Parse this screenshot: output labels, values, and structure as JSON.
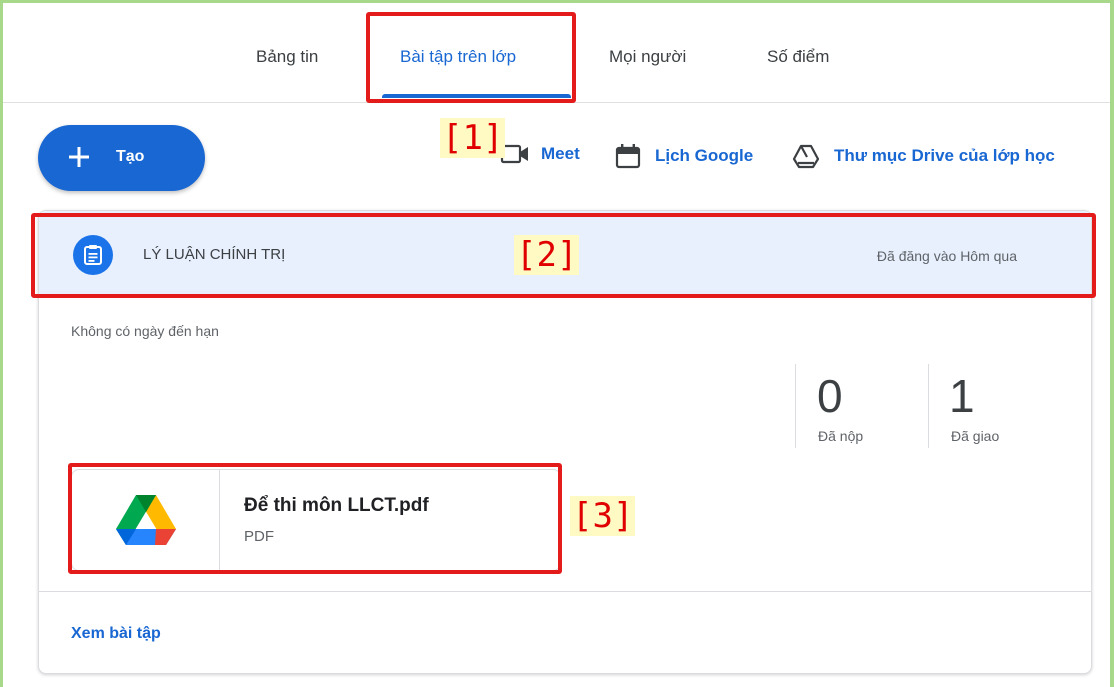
{
  "tabs": [
    {
      "label": "Bảng tin"
    },
    {
      "label": "Bài tập trên lớp",
      "active": true
    },
    {
      "label": "Mọi người"
    },
    {
      "label": "Số điểm"
    }
  ],
  "create_button": {
    "label": "Tạo",
    "icon": "plus-icon"
  },
  "tools": {
    "meet": "Meet",
    "calendar": "Lịch Google",
    "drive": "Thư mục Drive của lớp học"
  },
  "annotations": {
    "a1": "[1]",
    "a2": "[2]",
    "a3": "[3]"
  },
  "assignment": {
    "title": "LÝ LUẬN CHÍNH TRỊ",
    "posted": "Đã đăng vào Hôm qua",
    "due": "Không có ngày đến hạn",
    "submitted_count": "0",
    "submitted_label": "Đã nộp",
    "assigned_count": "1",
    "assigned_label": "Đã giao",
    "attachment": {
      "name": "Để thi môn LLCT.pdf",
      "type": "PDF",
      "icon": "google-drive-icon"
    },
    "view_link": "Xem bài tập"
  },
  "colors": {
    "accent": "#1967d2",
    "header_bg": "#e8f0fe",
    "annotation_red": "#e41b1b"
  }
}
